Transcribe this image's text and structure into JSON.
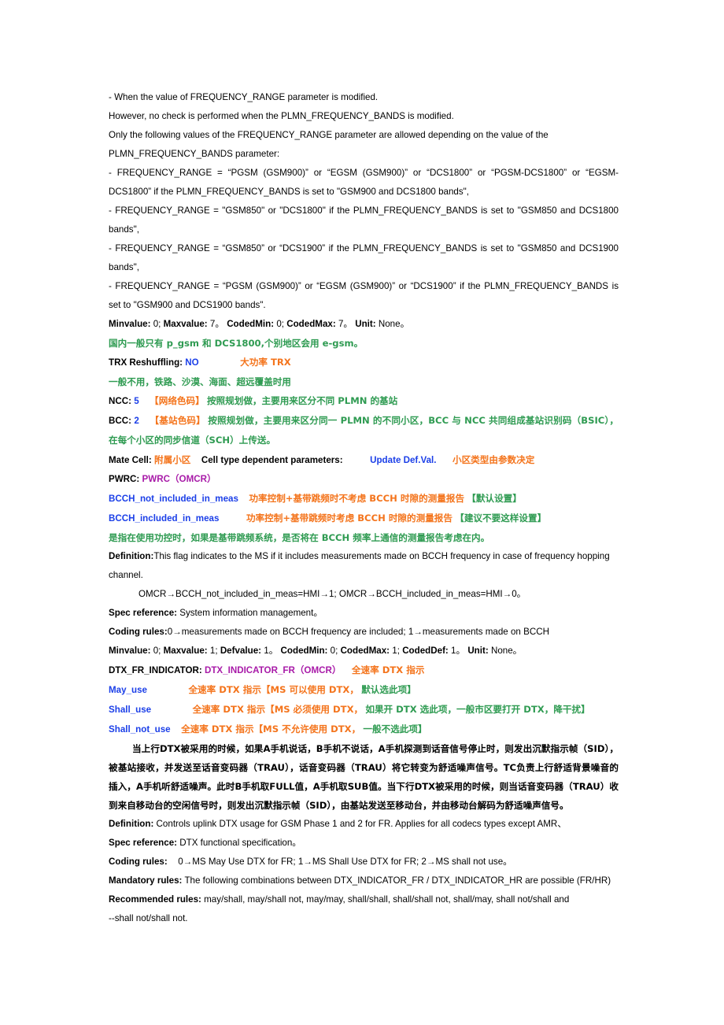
{
  "document": {
    "colors": {
      "black": "#000000",
      "blue": "#1b3fe8",
      "orange": "#f4741c",
      "green": "#2f9b52",
      "magenta": "#a81aa8"
    },
    "lines": {
      "l01": "- When the value of FREQUENCY_RANGE parameter is modified.",
      "l02": "However, no check is performed when the PLMN_FREQUENCY_BANDS is modified.",
      "l03": "Only the following values of the FREQUENCY_RANGE parameter are allowed depending on the value of the PLMN_FREQUENCY_BANDS parameter:",
      "l04": "- FREQUENCY_RANGE =   “PGSM (GSM900)”   or   “EGSM (GSM900)”   or   “DCS1800”   or   “PGSM-DCS1800”   or   “EGSM-DCS1800”   if the PLMN_FREQUENCY_BANDS is set to \"GSM900 and DCS1800 bands\",",
      "l05": "- FREQUENCY_RANGE =  \"GSM850\"   or  \"DCS1800\"   if the PLMN_FREQUENCY_BANDS is set to      \"GSM850 and DCS1800 bands\",",
      "l06": "- FREQUENCY_RANGE =   “GSM850”   or   “DCS1900”   if the PLMN_FREQUENCY_BANDS is set to \"GSM850 and DCS1900 bands\",",
      "l07": "-  FREQUENCY_RANGE  =   “PGSM  (GSM900)”   or   “EGSM  (GSM900)”   or   “DCS1900”   if  the PLMN_FREQUENCY_BANDS is set to \"GSM900 and DCS1900 bands\"."
    },
    "minvalue_row_1": {
      "k1": "Minvalue:",
      "v1": "0;",
      "k2": "Maxvalue:",
      "v2": "7。",
      "k3": "CodedMin:",
      "v3": "0;",
      "k4": "CodedMax:",
      "v4": "7。",
      "k5": "Unit:",
      "v5": "None。"
    },
    "note_gsm": "国内一般只有 p_gsm 和 DCS1800,个别地区会用 e-gsm。",
    "trx_reshuffling": {
      "label": "TRX Reshuffling:",
      "value": "NO",
      "annotation": "大功率 TRX"
    },
    "trx_note": "一般不用，铁路、沙漠、海面、超远覆盖时用",
    "ncc": {
      "label": "NCC:",
      "value": "5",
      "tag": "【网络色码】",
      "desc": "按照规划做，主要用来区分不同 PLMN 的基站"
    },
    "bcc": {
      "label": "BCC:",
      "value": "2",
      "tag": "【基站色码】",
      "desc": "按照规划做，主要用来区分同一 PLMN 的不同小区，BCC 与 NCC 共同组成基站识别码（BSIC），在每个小区的同步信道（SCH）上传送。"
    },
    "mate_cell": {
      "label": "Mate Cell:",
      "value": "附属小区",
      "label2": "Cell type dependent parameters:",
      "value2": "Update Def.Val.",
      "annotation": "小区类型由参数决定"
    },
    "pwrc": {
      "label": "PWRC:",
      "value": "PWRC（OMCR）"
    },
    "bcch_not_included": {
      "label": "BCCH_not_included_in_meas",
      "desc_orange": "功率控制+基带跳频时不考虑 BCCH 时隙的测量报告",
      "desc_green": "【默认设置】"
    },
    "bcch_included": {
      "label": "BCCH_included_in_meas",
      "desc_orange": "功率控制+基带跳频时考虑 BCCH 时隙的测量报告",
      "desc_green": "【建议不要这样设置】"
    },
    "bcch_note": "是指在使用功控时，如果是基带跳频系统，是否将在 BCCH 频率上通信的测量报告考虑在内。",
    "definition_1": {
      "label": "Definition:",
      "text": "This flag indicates to the MS if it includes measurements made on BCCH frequency in case of frequency hopping channel."
    },
    "omcr_line": "OMCR→BCCH_not_included_in_meas=HMI→1;   OMCR→BCCH_included_in_meas=HMI→0。",
    "spec_reference_1": {
      "label": "Spec reference:",
      "text": "System information management。"
    },
    "coding_rules_1": {
      "label": "Coding rules:",
      "text": "0→measurements made on BCCH frequency are included;  1→measurements made on BCCH"
    },
    "minvalue_row_2": {
      "k1": "Minvalue:",
      "v1": "0;",
      "k2": "Maxvalue:",
      "v2": "1;",
      "k3": "Defvalue:",
      "v3": "1。",
      "k4": "CodedMin:",
      "v4": "0;",
      "k5": "CodedMax:",
      "v5": "1;",
      "k6": "CodedDef:",
      "v6": "1。",
      "k7": "Unit:",
      "v7": "None。"
    },
    "dtx_fr_indicator": {
      "label": "DTX_FR_INDICATOR:",
      "value": "DTX_INDICATOR_FR（OMCR）",
      "annotation": "全速率 DTX 指示"
    },
    "dtx_options": [
      {
        "label": "May_use",
        "desc_orange": "全速率 DTX 指示【MS 可以使用 DTX，",
        "desc_green": "默认选此项】"
      },
      {
        "label": "Shall_use",
        "desc_orange": "全速率 DTX 指示【MS 必须使用 DTX，",
        "desc_green": "如果开 DTX 选此项，一般市区要打开 DTX，降干扰】"
      },
      {
        "label": "Shall_not_use",
        "desc_orange": "全速率 DTX 指示【MS 不允许使用 DTX，",
        "desc_green": "一般不选此项】"
      }
    ],
    "dtx_paragraph": "当上行DTX被采用的时候，如果A手机说话，B手机不说话，A手机探测到话音信号停止时，则发出沉默指示帧（SID），被基站接收，并发送至话音变码器（TRAU），话音变码器（TRAU）将它转变为舒适噪声信号。TC负责上行舒适背景噪音的插入，A手机听舒适噪声。此时B手机取FULL值，A手机取SUB值。当下行DTX被采用的时候，则当话音变码器（TRAU）收到来自移动台的空闲信号时，则发出沉默指示帧（SID），由基站发送至移动台，并由移动台解码为舒适噪声信号。",
    "definition_2": {
      "label": "Definition:",
      "text": "Controls uplink DTX usage for GSM Phase 1 and 2 for FR. Applies for all codecs types except AMR、"
    },
    "spec_reference_2": {
      "label": "Spec reference:",
      "text": "DTX functional specification。"
    },
    "coding_rules_2": {
      "label": "Coding rules:",
      "text": "0→MS May Use DTX for FR;  1→MS Shall Use DTX for FR;  2→MS shall not use。"
    },
    "mandatory_rules": {
      "label": "Mandatory rules:",
      "text": "The following combinations between DTX_INDICATOR_FR / DTX_INDICATOR_HR are possible (FR/HR)"
    },
    "recommended_rules": {
      "label": "Recommended rules:",
      "text": "may/shall, may/shall not, may/may, shall/shall, shall/shall not, shall/may, shall not/shall and",
      "text2": "--shall not/shall not."
    }
  }
}
